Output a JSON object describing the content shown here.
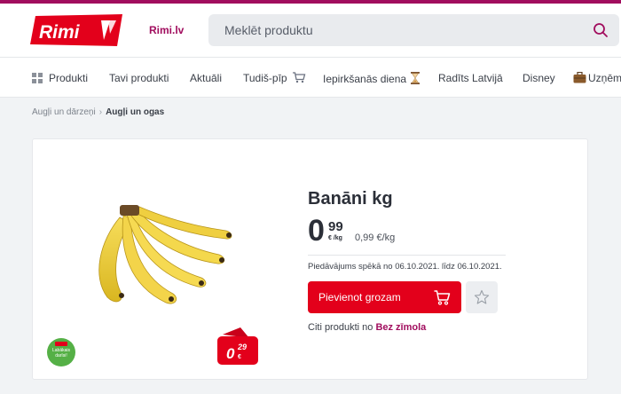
{
  "header": {
    "logo_text": "Rimi",
    "site_link": "Rimi.lv",
    "search_placeholder": "Meklēt produktu",
    "brand_color": "#e3001b",
    "accent_color": "#a10d5e"
  },
  "nav": {
    "items": [
      {
        "label": "Produkti",
        "icon": "grid-icon"
      },
      {
        "label": "Tavi produkti"
      },
      {
        "label": "Aktuāli"
      },
      {
        "label": "Tudiš-pīp",
        "icon": "cart-icon"
      },
      {
        "label": "Iepirkšanās diena",
        "icon": "hourglass-icon"
      },
      {
        "label": "Radīts Latvijā"
      },
      {
        "label": "Disney"
      },
      {
        "label": "Uzņēm",
        "icon": "briefcase-icon"
      }
    ]
  },
  "breadcrumb": {
    "items": [
      "Augļi un dārzeņi",
      "Augļi un ogas"
    ]
  },
  "product": {
    "title": "Banāni kg",
    "price_euros": "0",
    "price_cents": "99",
    "price_unit": "€ /kg",
    "unit_price": "0,99 €/kg",
    "offer_text": "Piedāvājums spēkā no 06.10.2021. līdz 06.10.2021.",
    "add_to_cart_label": "Pievienot grozam",
    "other_products_prefix": "Citi produkti no",
    "other_products_brand": "Bez zīmola",
    "green_badge_text": "Labākais darīsi!",
    "tag_price_euros": "0",
    "tag_price_cents": "29",
    "tag_currency": "€"
  }
}
